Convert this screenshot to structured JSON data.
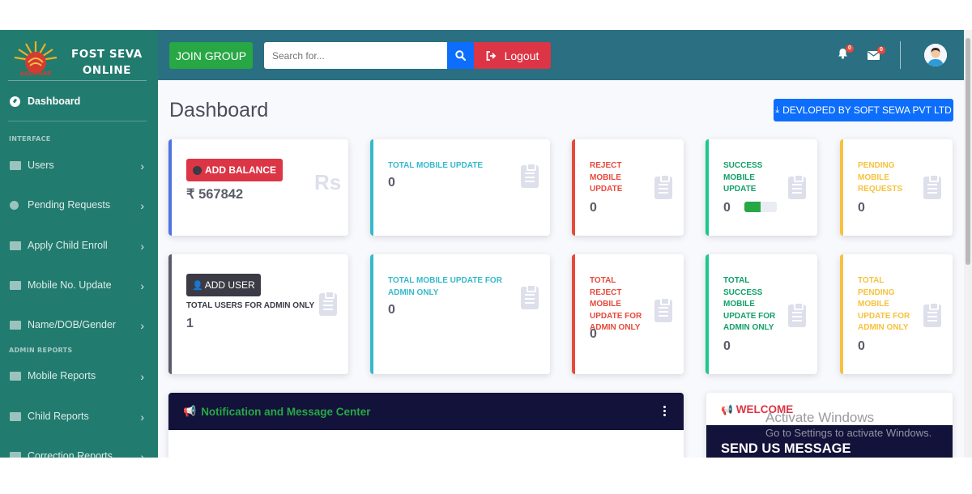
{
  "brand": {
    "line1": "FOST SEVA",
    "line2": "ONLINE",
    "logo_text": "AADHAAR"
  },
  "sidebar": {
    "dashboard": "Dashboard",
    "heading_interface": "INTERFACE",
    "heading_admin_reports": "ADMIN REPORTS",
    "items": [
      {
        "label": "Users"
      },
      {
        "label": "Pending Requests"
      },
      {
        "label": "Apply Child Enroll"
      },
      {
        "label": "Mobile No. Update"
      },
      {
        "label": "Name/DOB/Gender"
      },
      {
        "label": "Mobile Reports"
      },
      {
        "label": "Child Reports"
      },
      {
        "label": "Correction Reports"
      }
    ]
  },
  "topbar": {
    "join_group": "JOIN GROUP",
    "search_placeholder": "Search for...",
    "logout": "Logout",
    "alerts_count": "0",
    "messages_count": "0"
  },
  "main": {
    "title": "Dashboard",
    "dev_button": "DEVLOPED BY SOFT SEWA PVT LTD",
    "balance": {
      "button": "ADD BALANCE",
      "value": "₹ 567842",
      "icon_text": "Rs"
    },
    "cards_row1": [
      {
        "title": "TOTAL MOBILE UPDATE",
        "value": "0"
      },
      {
        "title": "REJECT MOBILE UPDATE",
        "value": "0"
      },
      {
        "title": "SUCCESS MOBILE UPDATE",
        "value": "0",
        "progress": 0.5
      },
      {
        "title": "PENDING MOBILE REQUESTS",
        "value": "0"
      }
    ],
    "users": {
      "button": "ADD USER",
      "title": "TOTAL USERS FOR ADMIN ONLY",
      "value": "1"
    },
    "cards_row2": [
      {
        "title": "TOTAL MOBILE UPDATE FOR ADMIN ONLY",
        "value": "0"
      },
      {
        "title": "TOTAL REJECT MOBILE UPDATE FOR ADMIN ONLY",
        "value": "0"
      },
      {
        "title": "TOTAL SUCCESS MOBILE UPDATE FOR ADMIN ONLY",
        "value": "0"
      },
      {
        "title": "TOTAL PENDING MOBILE UPDATE FOR ADMIN ONLY",
        "value": "0"
      }
    ],
    "notification": {
      "title": "Notification and Message Center"
    },
    "welcome": {
      "title": "WELCOME",
      "message": "SEND US MESSAGE"
    }
  },
  "watermark": {
    "title": "Activate Windows",
    "subtitle": "Go to Settings to activate Windows."
  },
  "colors": {
    "sidebar": "#227b6f",
    "topbar": "#2a6f82",
    "primary": "#4e73df",
    "info": "#36b9cc",
    "danger": "#e74a3b",
    "success": "#1cc88a",
    "warning": "#f6c23e",
    "dark": "#5a5c69"
  }
}
